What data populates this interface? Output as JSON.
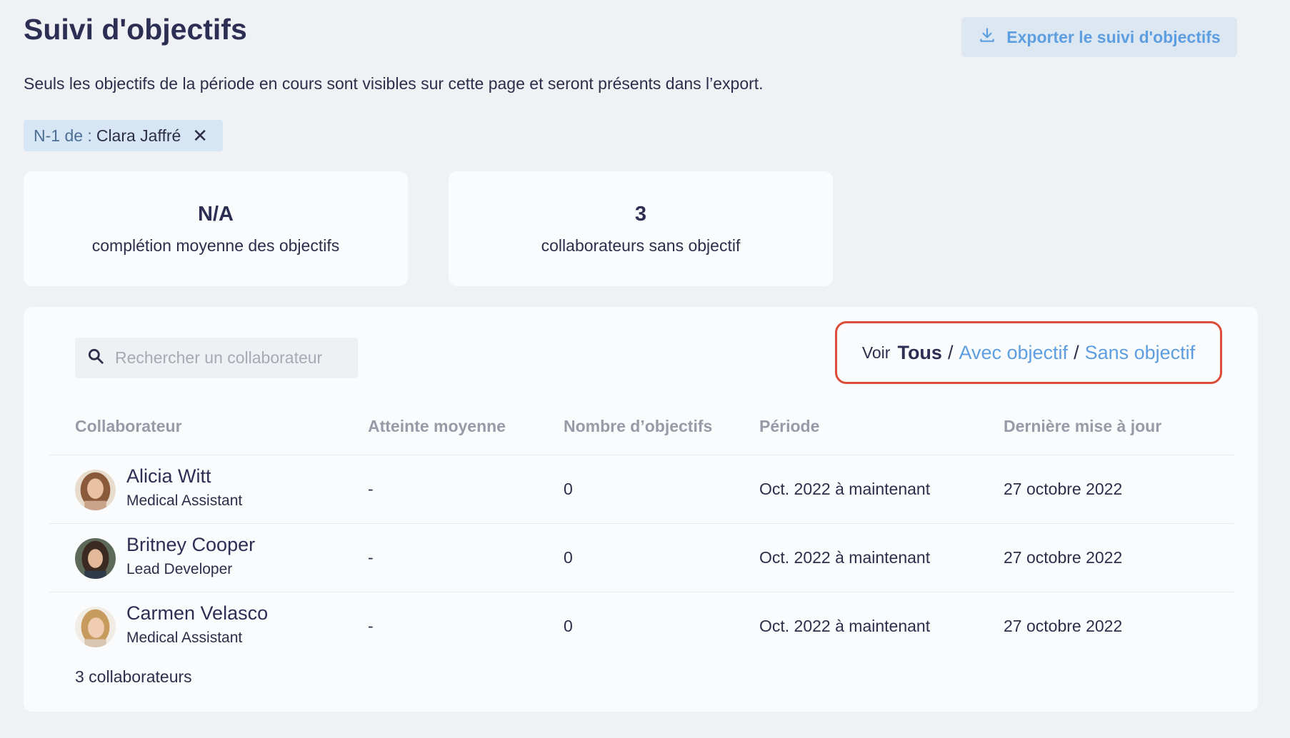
{
  "header": {
    "title": "Suivi d'objectifs",
    "export_label": "Exporter le suivi d'objectifs",
    "subtitle": "Seuls les objectifs de la période en cours sont visibles sur cette page et seront présents dans l’export."
  },
  "filter_chip": {
    "prefix": "N-1 de :",
    "value": "Clara Jaffré",
    "close_glyph": "✕"
  },
  "stats": [
    {
      "value": "N/A",
      "label": "complétion moyenne des objectifs"
    },
    {
      "value": "3",
      "label": "collaborateurs sans objectif"
    }
  ],
  "search": {
    "placeholder": "Rechercher un collaborateur",
    "value": ""
  },
  "view_filter": {
    "label": "Voir",
    "active": "Tous",
    "separator": "/",
    "with_objective": "Avec objectif",
    "without_objective": "Sans objectif"
  },
  "table": {
    "columns": [
      "Collaborateur",
      "Atteinte moyenne",
      "Nombre d’objectifs",
      "Période",
      "Dernière mise à jour"
    ],
    "rows": [
      {
        "name": "Alicia Witt",
        "role": "Medical Assistant",
        "average": "-",
        "count": "0",
        "period": "Oct. 2022 à maintenant",
        "updated": "27 octobre 2022"
      },
      {
        "name": "Britney Cooper",
        "role": "Lead Developer",
        "average": "-",
        "count": "0",
        "period": "Oct. 2022 à maintenant",
        "updated": "27 octobre 2022"
      },
      {
        "name": "Carmen Velasco",
        "role": "Medical Assistant",
        "average": "-",
        "count": "0",
        "period": "Oct. 2022 à maintenant",
        "updated": "27 octobre 2022"
      }
    ],
    "footer": "3 collaborateurs"
  },
  "colors": {
    "accent": "#5d9ee0",
    "highlight_border": "#dd4b39",
    "title": "#2c2e54"
  },
  "icons": {
    "export": "download-icon",
    "search": "search-icon",
    "chip_close": "close-icon"
  }
}
